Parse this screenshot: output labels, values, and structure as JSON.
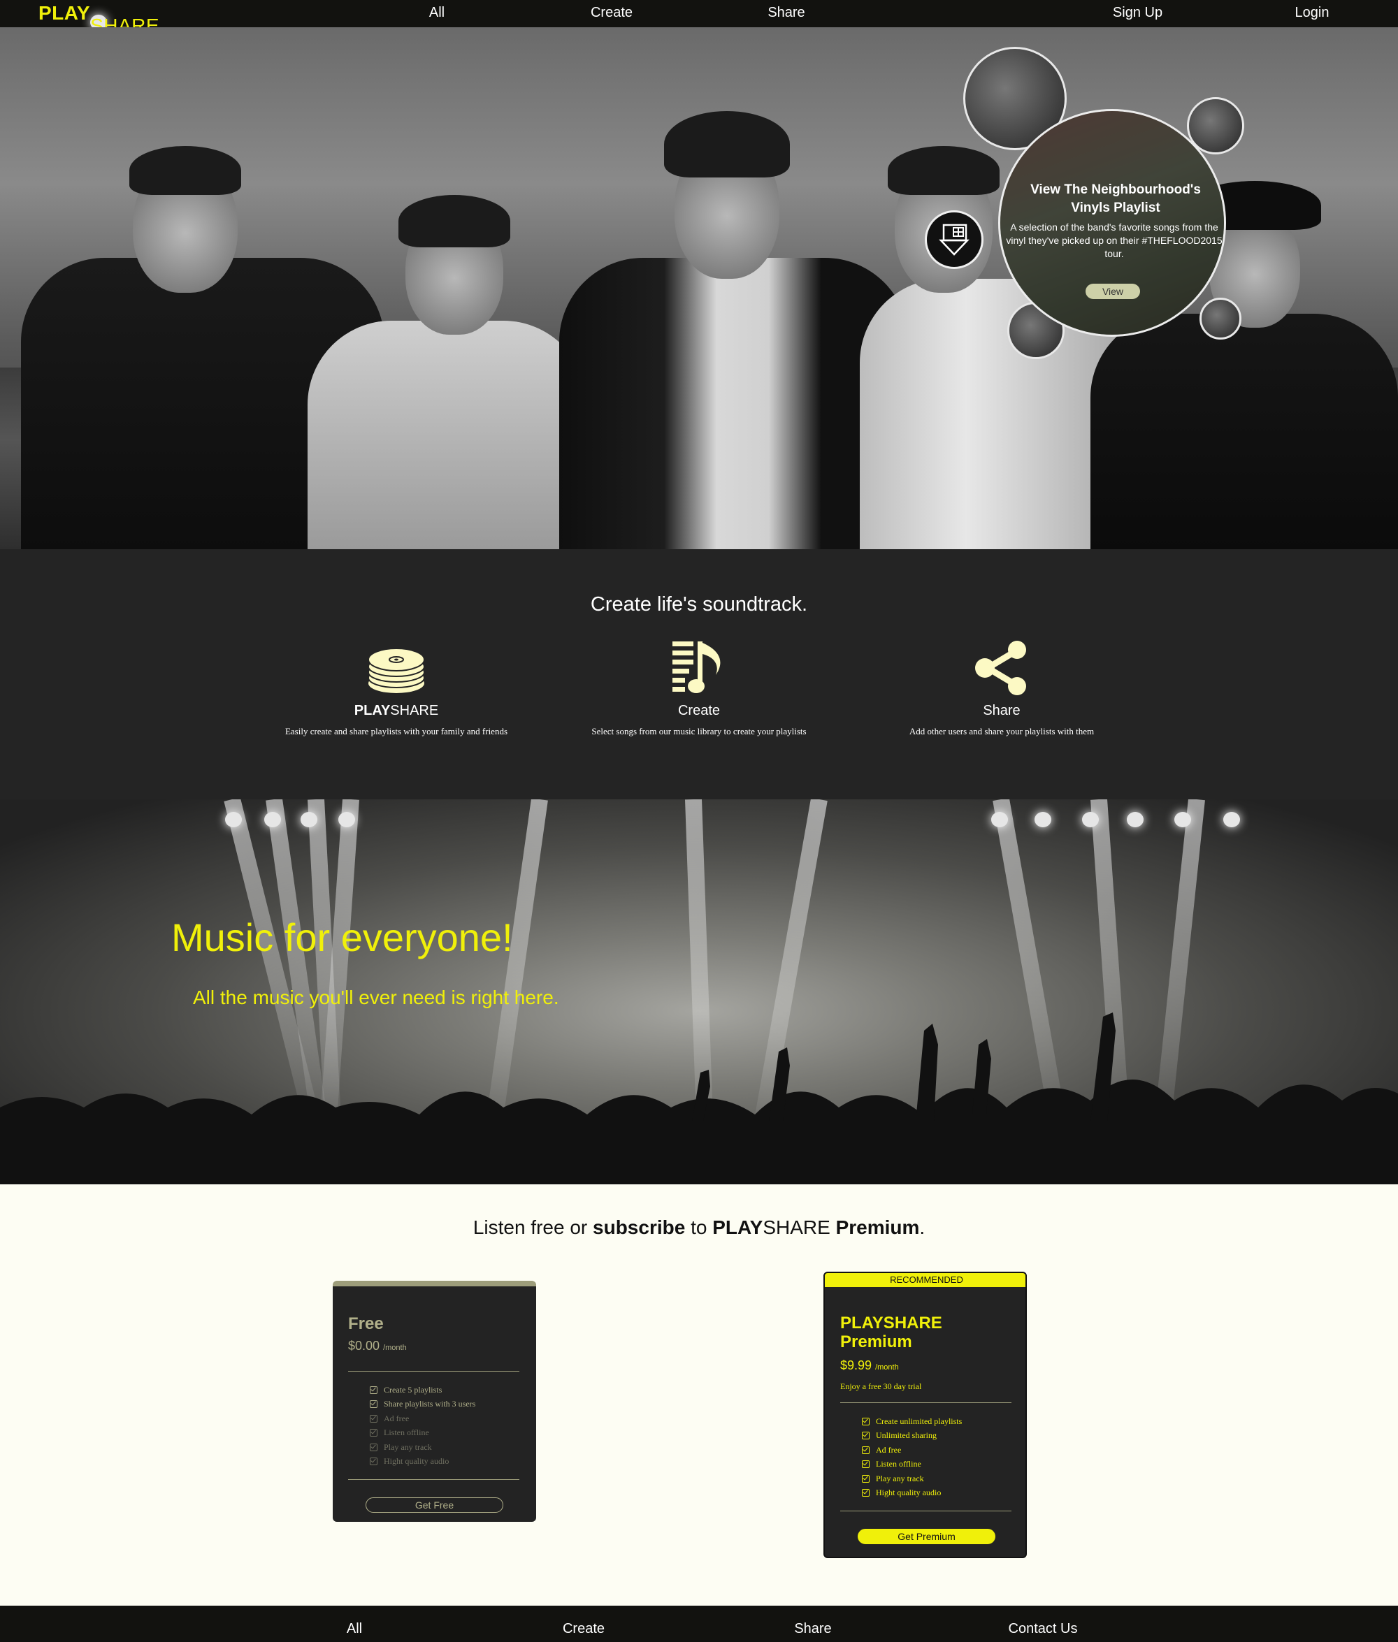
{
  "nav": {
    "logo_bold": "PLAY",
    "logo_light": "SHARE",
    "links": [
      "All",
      "Create",
      "Share"
    ],
    "signup": "Sign Up",
    "login": "Login"
  },
  "hero": {
    "featured": {
      "title": "View The Neighbourhood's Vinyls Playlist",
      "description": "A selection of the band's favorite songs from the vinyl they've picked up on their #THEFLOOD2015 tour.",
      "button": "View"
    }
  },
  "soundtrack": {
    "heading": "Create life's soundtrack.",
    "features": [
      {
        "icon": "disc-stack-icon",
        "title_bold": "PLAY",
        "title_light": "SHARE",
        "subtitle": "Easily create and share playlists with your family and friends"
      },
      {
        "icon": "playlist-music-icon",
        "title": "Create",
        "subtitle": "Select songs from our music library to create your playlists"
      },
      {
        "icon": "share-icon",
        "title": "Share",
        "subtitle": "Add other users and share your playlists with them"
      }
    ]
  },
  "banner": {
    "headline": "Music for everyone!",
    "tagline": "All the music you'll ever need is right here."
  },
  "pricing": {
    "heading_1": "Listen free or ",
    "heading_2": "subscribe",
    "heading_3": " to ",
    "heading_4": "PLAY",
    "heading_5": "SHARE",
    "heading_6": " Premium",
    "heading_7": ".",
    "free": {
      "title": "Free",
      "price": "$0.00",
      "period": "/month",
      "features": [
        "Create 5 playlists",
        "Share playlists with 3 users",
        "Ad free",
        "Listen offline",
        "Play any track",
        "Hight quality audio"
      ],
      "included": [
        true,
        true,
        false,
        false,
        false,
        false
      ],
      "button": "Get Free"
    },
    "premium": {
      "badge": "RECOMMENDED",
      "title_line1": "PLAYSHARE",
      "title_line2": "Premium",
      "price": "$9.99",
      "period": "/month",
      "trial": "Enjoy a free 30 day trial",
      "features": [
        "Create unlimited playlists",
        "Unlimited sharing",
        "Ad free",
        "Listen offline",
        "Play any track",
        "Hight quality audio"
      ],
      "button": "Get Premium"
    }
  },
  "footer": {
    "links": [
      "All",
      "Create",
      "Share",
      "Contact Us"
    ]
  },
  "colors": {
    "accent": "#f0f00a",
    "dark": "#12120f",
    "panel": "#242424",
    "muted_olive": "#9d9d7a",
    "cream": "#fdfdf3"
  }
}
